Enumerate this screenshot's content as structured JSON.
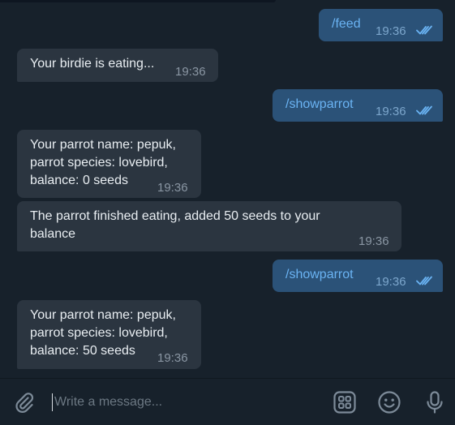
{
  "messages": [
    {
      "direction": "out",
      "text": "/feed",
      "time": "19:36",
      "status_icon": "double-check-icon"
    },
    {
      "direction": "in",
      "text": "Your birdie is eating...",
      "time": "19:36"
    },
    {
      "direction": "out",
      "text": "/showparrot",
      "time": "19:36",
      "status_icon": "double-check-icon"
    },
    {
      "direction": "in",
      "text": "Your parrot name: pepuk,\nparrot species: lovebird,\nbalance: 0 seeds",
      "time": "19:36"
    },
    {
      "direction": "in",
      "text": "The parrot finished eating, added 50 seeds to your\nbalance",
      "time": "19:36"
    },
    {
      "direction": "out",
      "text": "/showparrot",
      "time": "19:36",
      "status_icon": "double-check-icon"
    },
    {
      "direction": "in",
      "text": "Your parrot name: pepuk,\nparrot species: lovebird,\nbalance: 50 seeds",
      "time": "19:36"
    }
  ],
  "composer": {
    "placeholder": "Write a message...",
    "icons": [
      "attach-icon",
      "bot-commands-icon",
      "emoji-icon",
      "microphone-icon"
    ]
  },
  "colors": {
    "background": "#0e1621",
    "incoming_bubble": "#2b3540",
    "outgoing_bubble": "#2b5278",
    "link_text": "#6ab3f3",
    "check_marks": "#6ab3f3"
  }
}
